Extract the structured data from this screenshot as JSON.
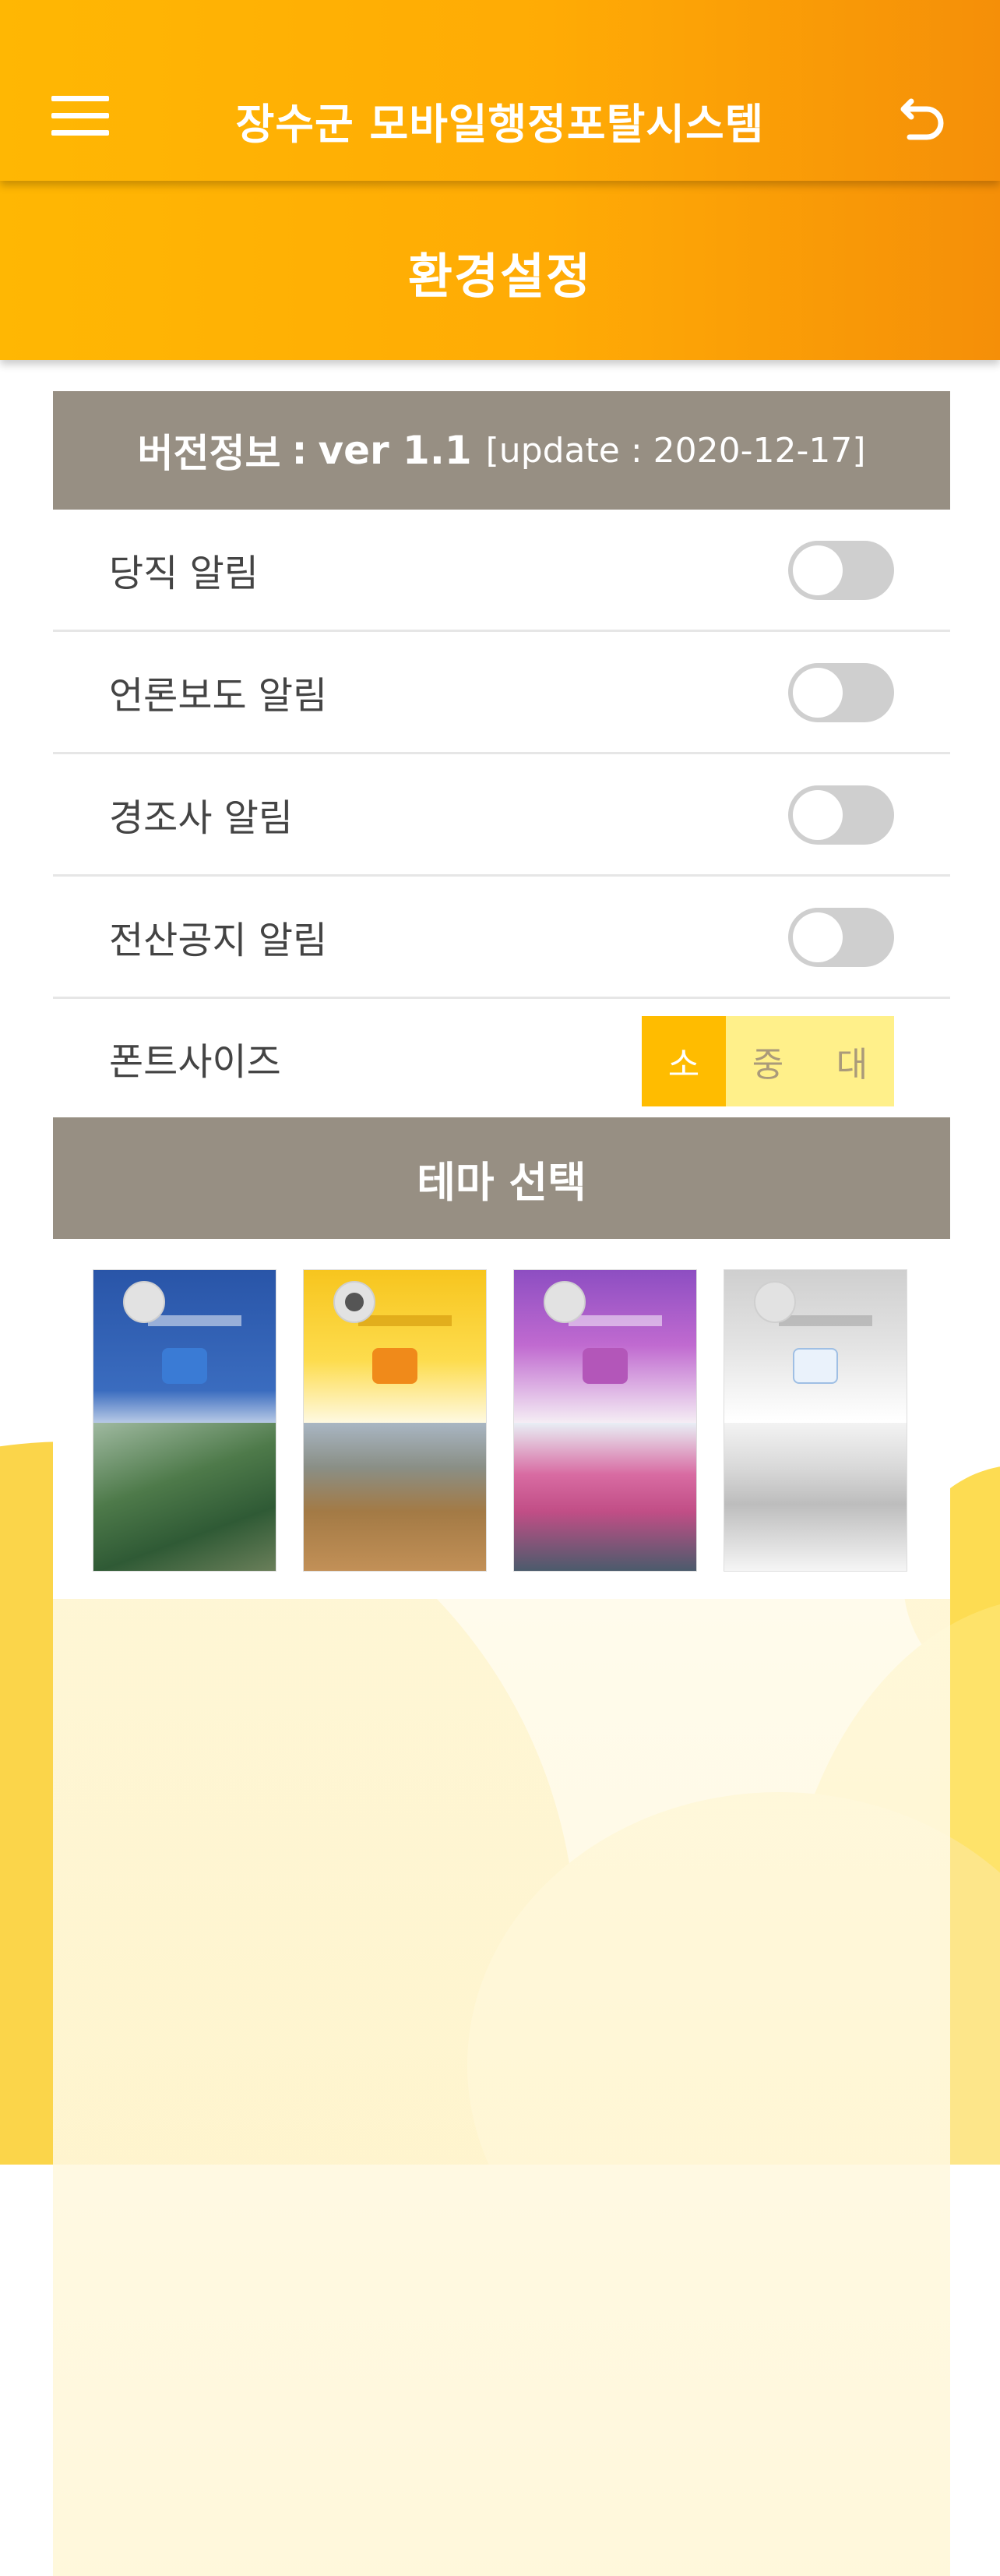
{
  "header": {
    "app_title": "장수군 모바일행정포탈시스템",
    "menu_icon": "hamburger-menu-icon",
    "back_icon": "back-arrow-icon"
  },
  "page": {
    "title": "환경설정"
  },
  "version": {
    "label": "버전정보",
    "separator": ":",
    "value": "ver 1.1",
    "update": "[update : 2020-12-17]"
  },
  "settings": [
    {
      "label": "당직 알림",
      "enabled": false
    },
    {
      "label": "언론보도 알림",
      "enabled": false
    },
    {
      "label": "경조사 알림",
      "enabled": false
    },
    {
      "label": "전산공지 알림",
      "enabled": false
    }
  ],
  "font_size": {
    "label": "폰트사이즈",
    "options": [
      "소",
      "중",
      "대"
    ],
    "selected": "소"
  },
  "theme": {
    "title": "테마 선택",
    "options": [
      {
        "name": "blue-mountain",
        "selected": false
      },
      {
        "name": "yellow-field",
        "selected": true
      },
      {
        "name": "purple-blossom",
        "selected": false
      },
      {
        "name": "gray-winter",
        "selected": false
      }
    ]
  },
  "colors": {
    "header": "#ffb703",
    "section_bar": "#978f83",
    "segment_active": "#ffbc00",
    "segment_inactive": "#fff08a",
    "toggle_off": "#cfcfcf"
  }
}
